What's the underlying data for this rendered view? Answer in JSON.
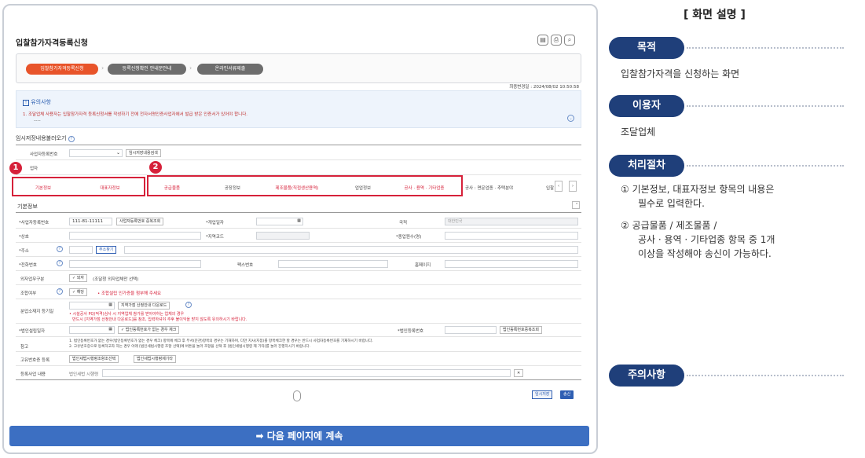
{
  "screen": {
    "title": "입찰참가자격등록신청",
    "icons": [
      "print-icon",
      "save-icon",
      "zoom-icon"
    ]
  },
  "steps": [
    {
      "label": "입찰참가자격등록신청",
      "active": true
    },
    {
      "label": "등록신청확인 안내문안내",
      "active": false
    },
    {
      "label": "온라인서류제출",
      "active": false
    }
  ],
  "notice": {
    "title": "유의사항",
    "text": "1. 조달업체 사용자는 입찰참가자격 등록신청서를 작성하기 전에 전자서명인증사업자에서 발급 받은 인증서가 있어야 합니다.",
    "dash": "----",
    "last_modified": "최종변경일 : 2024/08/02 10:50:58"
  },
  "temp_load": {
    "title": "임시저장내용불러오기",
    "bizno_label": "사업자등록번호",
    "search_button": "임시저장내용검색",
    "row2_label": "업자"
  },
  "tabs_group1": [
    "기본정보",
    "대표자정보"
  ],
  "tabs_group2": [
    "공급물품",
    "공장정보",
    "제조물품(직접생산용역)",
    "업업정보",
    "공사 · 용역 · 기타업종"
  ],
  "tabs_extra": [
    "공사 : 면문업종 · 추택분야",
    "입찰"
  ],
  "basic": {
    "section": "기본정보",
    "bizno_label": "*사업자등록번호",
    "bizno_value": "111-81-11111",
    "bizno_button": "사업자등록번호 중복조회",
    "opendate_label": "*개업일자",
    "nation_label": "국적",
    "nation_value": "대한민국",
    "company_label": "*상호",
    "region_label": "*지역코드",
    "employees_label": "*종업원수(명)",
    "address_label": "*주소",
    "address_button": "주소찾기",
    "phone_label": "*전화번호",
    "fax_label": "팩스번호",
    "homepage_label": "홈페이지",
    "foreign_label": "외자업무구분",
    "foreign_check": "외자",
    "foreign_note": "(조달청 외자업체만 선택)",
    "union_label": "조합여부",
    "union_check": "해당",
    "union_note": "• 조합설립 인가증을 첨부해 주세요",
    "branch_label": "분업소재지 등기일",
    "branch_button": "지역가점 산정안내 다운로드",
    "branch_note1": "• 시설공사 PQ(적격)심사 시 지역업체 참가를 받아야하는 업체의 경우",
    "branch_note2": "반드시 [지역가점 산정안내 다운로드]를 참조, 입력하셔야 추후 불이익을 받지 않도록 유의하시기 바랍니다.",
    "corpdate_label": "*법인설립일자",
    "corpdate_check": "법인등록번호가 없는 경우 체크",
    "corpno_label": "*법인등록번호",
    "corpno_button": "법인등록번호중복조회",
    "ref_label": "참고",
    "ref_text1": "1. 법인등록번호가 없는 경우(법인등록번호가 없는 경우 체크) 항목에 체크 후 무서(문관)항목의 경우는 기재하며, 다만 지사(지점)를 항목체크한 할 경우는 반드시 사업자등록번호를 기재하시기 바랍니다.",
    "ref_text2": "2. 고유번호증으로 등록하고자 하는 경우 아래 [법인세법시행령 조항 선택]에 버튼을 눌러 조항을 선택 후 [법인세법시행령 제 기타]를 눌러 진행하시기 바랍니다.",
    "unique_label": "고유번호증 등록",
    "unique_btn1": "법인세법시행령조항조선택",
    "unique_btn2": "법인세법시행령제기타",
    "biz_label": "등록사업 내용",
    "biz_placeholder": "법인세법 시행령"
  },
  "actions": {
    "temp_save": "임시저장",
    "send": "송신"
  },
  "continue": "➡ 다음 페이지에 계속",
  "panel": {
    "title": "[ 화면 설명 ]",
    "purpose_label": "목적",
    "purpose_text": "입찰참가자격을 신청하는 화면",
    "user_label": "이용자",
    "user_text": "조달업체",
    "process_label": "처리절차",
    "process_1": "① 기본정보, 대표자정보 항목의 내용은",
    "process_1b": "필수로 입력한다.",
    "process_2": "② 공급물품 / 제조물품 /",
    "process_2b": "공사 · 용역 · 기타업종 항목 중 1개",
    "process_2c": "이상을 작성해야 송신이 가능하다.",
    "caution_label": "주의사항"
  },
  "markers": [
    "1",
    "2"
  ],
  "colors": {
    "accent": "#1f3f7a",
    "highlight": "#d6213a",
    "button": "#2f5fb3"
  }
}
